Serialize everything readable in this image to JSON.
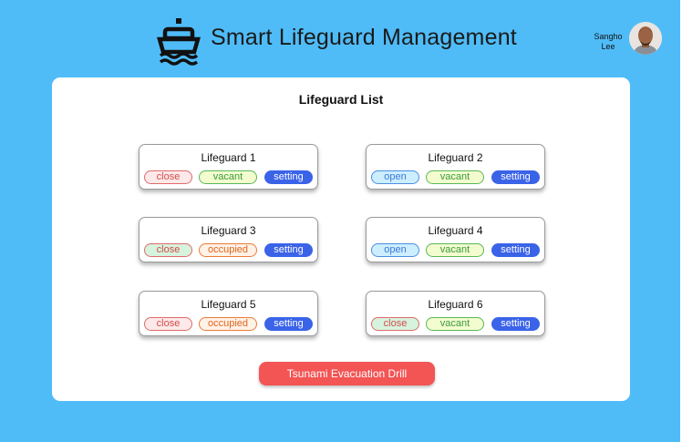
{
  "header": {
    "title": "Smart Lifeguard Management",
    "logo_icon": "lifeguard-boat-icon"
  },
  "user": {
    "name_line1": "Sangho",
    "name_line2": "Lee",
    "avatar_icon": "user-avatar"
  },
  "panel": {
    "title": "Lifeguard List"
  },
  "lifeguards": [
    {
      "name": "Lifeguard 1",
      "door": "close",
      "door_style": "close",
      "occupancy": "vacant",
      "occupancy_style": "vacant",
      "setting": "setting"
    },
    {
      "name": "Lifeguard 2",
      "door": "open",
      "door_style": "open",
      "occupancy": "vacant",
      "occupancy_style": "vacant",
      "setting": "setting"
    },
    {
      "name": "Lifeguard 3",
      "door": "close",
      "door_style": "close-g",
      "occupancy": "occupied",
      "occupancy_style": "occupied",
      "setting": "setting"
    },
    {
      "name": "Lifeguard 4",
      "door": "open",
      "door_style": "open",
      "occupancy": "vacant",
      "occupancy_style": "vacant",
      "setting": "setting"
    },
    {
      "name": "Lifeguard 5",
      "door": "close",
      "door_style": "close",
      "occupancy": "occupied",
      "occupancy_style": "occupied",
      "setting": "setting"
    },
    {
      "name": "Lifeguard 6",
      "door": "close",
      "door_style": "close-g",
      "occupancy": "vacant",
      "occupancy_style": "vacant",
      "setting": "setting"
    }
  ],
  "drill_button": {
    "label": "Tsunami Evacuation Drill",
    "color": "#f35454"
  },
  "colors": {
    "background": "#4fbcf8",
    "setting": "#3a63e8"
  }
}
